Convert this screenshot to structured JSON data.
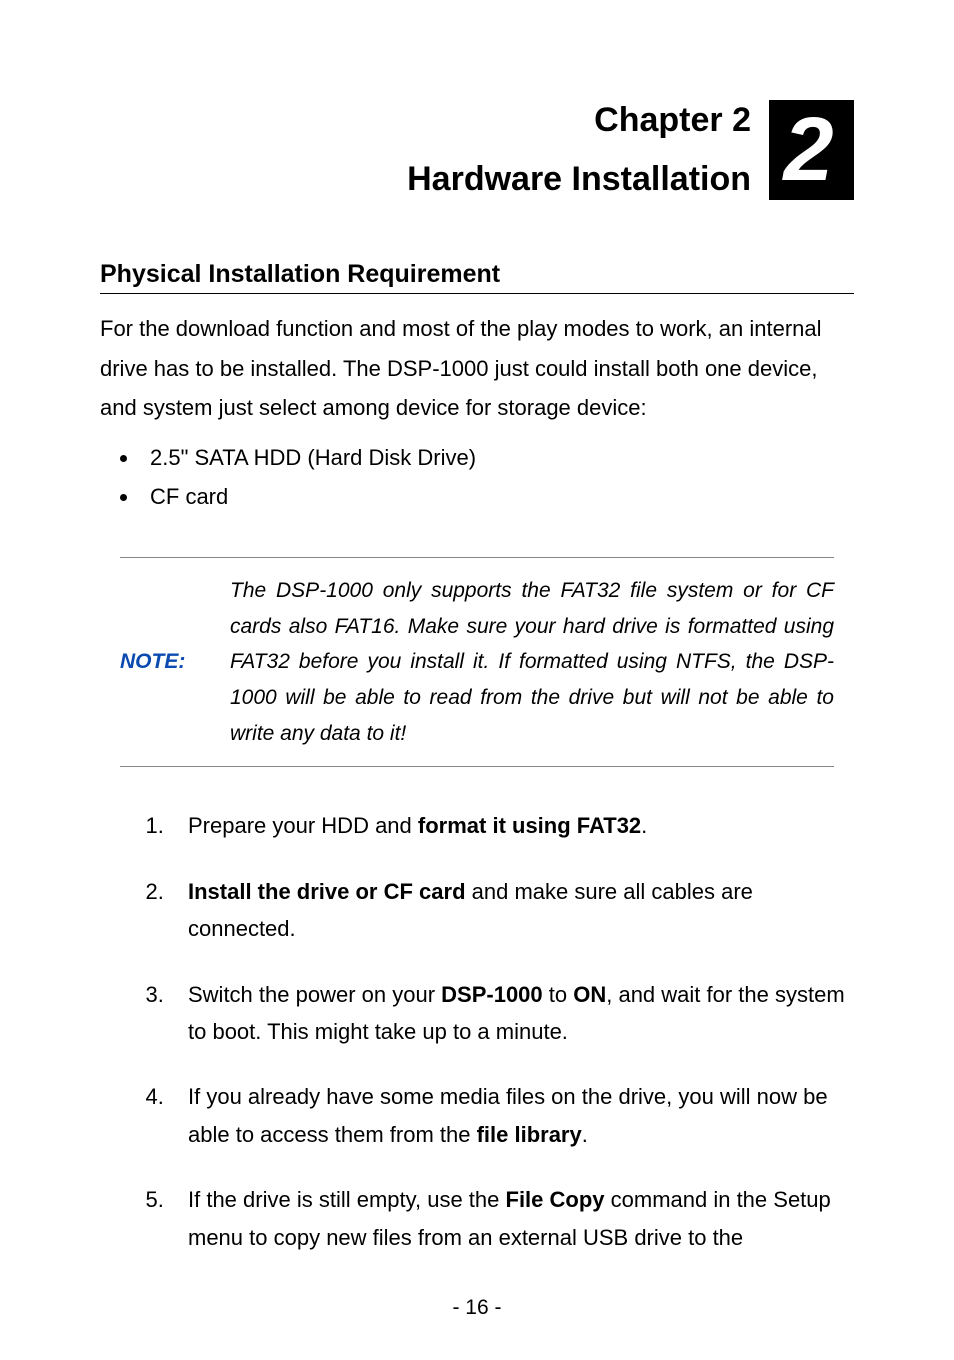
{
  "chapter": {
    "line1": "Chapter 2",
    "line2": "Hardware Installation",
    "badge": "2"
  },
  "section_title": "Physical Installation Requirement",
  "intro": "For the download function and most of the play modes to work, an internal drive has to be installed. The DSP-1000 just could install both one device, and system just select among device for storage device:",
  "bullets": [
    "2.5\" SATA HDD (Hard Disk Drive)",
    "CF card"
  ],
  "note": {
    "label": "NOTE:",
    "text": "The DSP-1000 only supports the FAT32 file system or for CF cards also FAT16. Make sure your hard drive is formatted using FAT32 before you install it. If formatted using NTFS, the DSP-1000 will be able to read from the drive but will not be able to write any data to it!"
  },
  "steps": [
    {
      "pre": "Prepare your HDD and ",
      "bold": "format it using FAT32",
      "post": "."
    },
    {
      "pre": "",
      "bold": "Install the drive or CF card",
      "post": " and make sure all cables are connected."
    },
    {
      "pre": "Switch the power on your ",
      "bold": "DSP-1000",
      "mid": " to ",
      "bold2": "ON",
      "post": ", and wait for the system to boot. This might take up to a minute."
    },
    {
      "pre": "If you already have some media files on the drive, you will now be able to access them from the ",
      "bold": "file library",
      "post": "."
    },
    {
      "pre": "If the drive is still empty, use the ",
      "bold": "File Copy",
      "post": " command in the Setup menu to copy new files from an external USB drive to the"
    }
  ],
  "page_number": "- 16 -"
}
